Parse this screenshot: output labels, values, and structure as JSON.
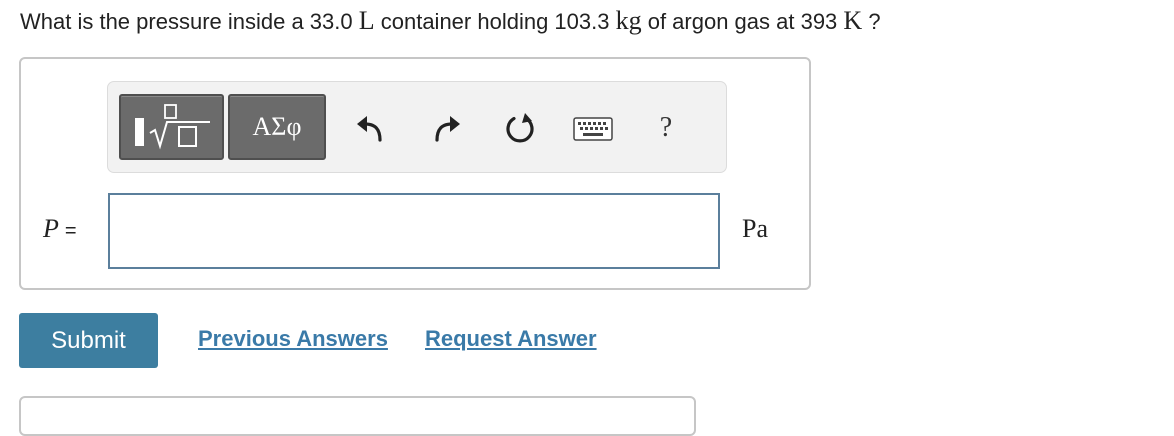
{
  "question": {
    "prefix": "What is the pressure inside a 33.0 ",
    "volume_unit": "L",
    "middle": " container holding 103.3 ",
    "mass_unit": "kg",
    "suffix1": " of argon gas at 393 ",
    "temp_unit": "K",
    "suffix2": " ?"
  },
  "toolbar": {
    "templates_icon": "templates-icon",
    "symbols_label": "ΑΣφ",
    "undo_icon": "undo-icon",
    "redo_icon": "redo-icon",
    "reset_icon": "reset-icon",
    "keyboard_icon": "keyboard-icon",
    "help_label": "?"
  },
  "answer": {
    "variable": "P",
    "equals": "=",
    "value": "",
    "unit": "Pa"
  },
  "actions": {
    "submit_label": "Submit",
    "previous_answers_label": "Previous Answers",
    "request_answer_label": "Request Answer"
  },
  "colors": {
    "submit_bg": "#3d7ea0",
    "link": "#3a7aa8",
    "input_border": "#5b7f9c",
    "toolbar_button": "#6b6b6b"
  }
}
